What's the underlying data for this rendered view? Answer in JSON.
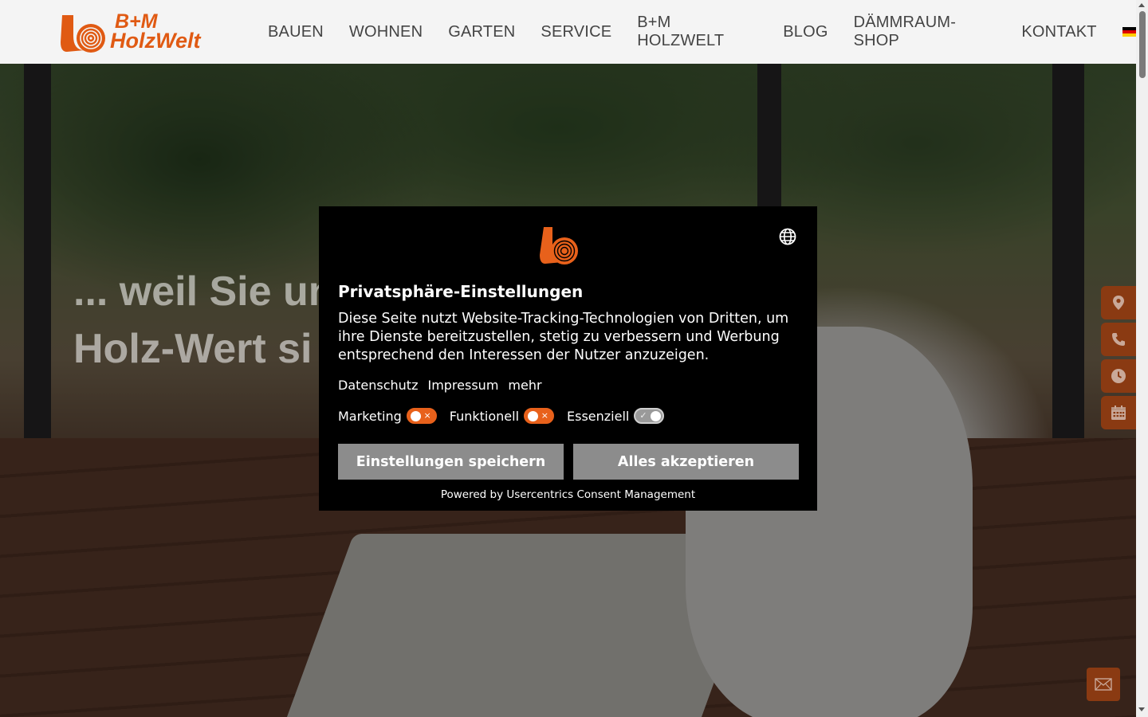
{
  "header": {
    "logo_line1": "B+M",
    "logo_line2": "HolzWelt",
    "nav": [
      {
        "label": "BAUEN"
      },
      {
        "label": "WOHNEN"
      },
      {
        "label": "GARTEN"
      },
      {
        "label": "SERVICE"
      },
      {
        "label": "B+M HOLZWELT"
      },
      {
        "label": "BLOG"
      },
      {
        "label": "DÄMMRAUM-SHOP"
      },
      {
        "label": "KONTAKT"
      }
    ],
    "language_icon": "flag-de-icon"
  },
  "hero": {
    "title": "... weil Sie un\nHolz-Wert si"
  },
  "side_buttons": {
    "icons": [
      "map-pin-icon",
      "phone-icon",
      "clock-icon",
      "calendar-icon"
    ],
    "mail_icon": "mail-icon"
  },
  "consent": {
    "title": "Privatsphäre-Einstellungen",
    "text": "Diese Seite nutzt Website-Tracking-Technologien von Dritten, um ihre Dienste bereitzustellen, stetig zu verbessern und Werbung entsprechend den Interessen der Nutzer anzuzeigen.",
    "links": {
      "privacy": "Datenschutz",
      "imprint": "Impressum",
      "more": "mehr"
    },
    "toggles": {
      "marketing": {
        "label": "Marketing",
        "enabled": false,
        "mark": "×"
      },
      "functional": {
        "label": "Funktionell",
        "enabled": false,
        "mark": "×"
      },
      "essential": {
        "label": "Essenziell",
        "enabled": true,
        "mark": "✓"
      }
    },
    "save_label": "Einstellungen speichern",
    "accept_label": "Alles akzeptieren",
    "powered_by": "Powered by Usercentrics Consent Management"
  },
  "colors": {
    "brand_orange": "#e05a13",
    "side_button": "#8a3a12",
    "dialog_bg": "#000000",
    "button_gray": "#8c8c8c"
  }
}
